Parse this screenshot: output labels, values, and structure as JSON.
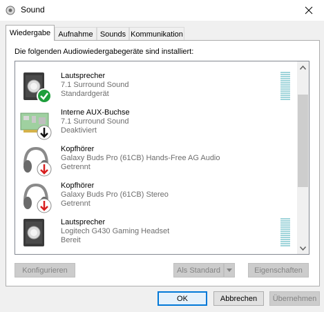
{
  "window": {
    "title": "Sound",
    "app_icon": "speaker-app-icon",
    "close_icon": "close-icon"
  },
  "tabs": [
    {
      "label": "Wiedergabe",
      "active": true
    },
    {
      "label": "Aufnahme",
      "active": false
    },
    {
      "label": "Sounds",
      "active": false
    },
    {
      "label": "Kommunikation",
      "active": false
    }
  ],
  "intro": "Die folgenden Audiowiedergabegeräte sind installiert:",
  "devices": [
    {
      "name": "Lautsprecher",
      "description": "7.1 Surround Sound",
      "status": "Standardgerät",
      "icon": "speaker-icon",
      "badge": "check-badge-icon",
      "level_meter": true
    },
    {
      "name": "Interne AUX-Buchse",
      "description": "7.1 Surround Sound",
      "status": "Deaktiviert",
      "icon": "sound-card-icon",
      "badge": "disabled-arrow-badge-icon",
      "level_meter": false
    },
    {
      "name": "Kopfhörer",
      "description": "Galaxy Buds Pro (61CB) Hands-Free AG Audio",
      "status": "Getrennt",
      "icon": "headphones-icon",
      "badge": "disconnected-arrow-badge-icon",
      "level_meter": false
    },
    {
      "name": "Kopfhörer",
      "description": "Galaxy Buds Pro (61CB) Stereo",
      "status": "Getrennt",
      "icon": "headphones-icon",
      "badge": "disconnected-arrow-badge-icon",
      "level_meter": false
    },
    {
      "name": "Lautsprecher",
      "description": "Logitech G430 Gaming Headset",
      "status": "Bereit",
      "icon": "speaker-icon",
      "badge": "",
      "level_meter": true
    }
  ],
  "buttons": {
    "configure": "Konfigurieren",
    "set_default": "Als Standard",
    "properties": "Eigenschaften",
    "ok": "OK",
    "cancel": "Abbrechen",
    "apply": "Übernehmen"
  },
  "colors": {
    "accent": "#0078d7",
    "check_green": "#1e9e3c",
    "disconnected_red": "#d81e1e",
    "meter": "#9fd4da"
  }
}
